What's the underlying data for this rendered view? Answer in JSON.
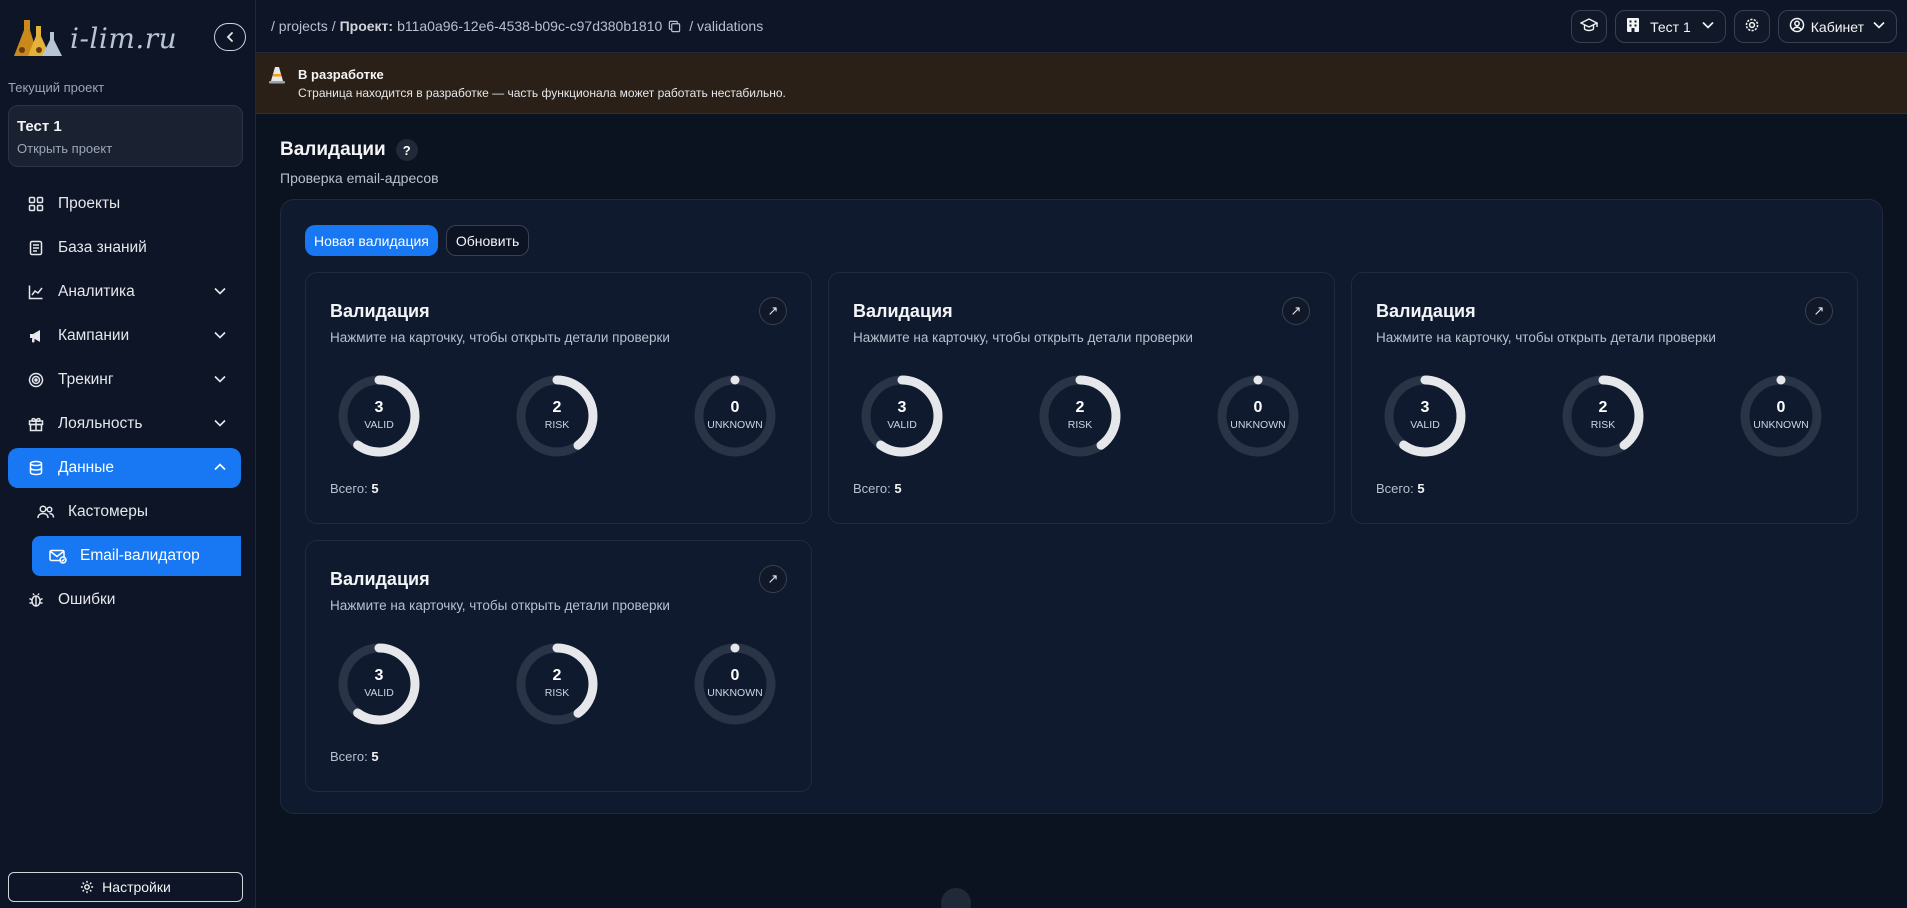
{
  "logo": {
    "text": "i-lim.ru"
  },
  "sidebar": {
    "current_project_label": "Текущий проект",
    "project": {
      "name": "Тест 1",
      "open_label": "Открыть проект"
    },
    "items": [
      {
        "label": "Проекты",
        "icon": "grid-icon"
      },
      {
        "label": "База знаний",
        "icon": "document-icon"
      },
      {
        "label": "Аналитика",
        "icon": "chart-icon",
        "expandable": true
      },
      {
        "label": "Кампании",
        "icon": "megaphone-icon",
        "expandable": true
      },
      {
        "label": "Трекинг",
        "icon": "target-icon",
        "expandable": true
      },
      {
        "label": "Лояльность",
        "icon": "gift-icon",
        "expandable": true
      },
      {
        "label": "Данные",
        "icon": "database-icon",
        "expandable": true,
        "active": true
      },
      {
        "label": "Ошибки",
        "icon": "bug-icon"
      }
    ],
    "sub_items": [
      {
        "label": "Кастомеры",
        "icon": "users-icon"
      },
      {
        "label": "Email-валидатор",
        "icon": "mail-check-icon",
        "active": true
      }
    ],
    "settings_label": "Настройки"
  },
  "topbar": {
    "crumb_projects": "/ projects /",
    "crumb_project_label": "Проект:",
    "crumb_project_id": "b11a0a96-12e6-4538-b09c-c97d380b1810",
    "crumb_current": "/ validations",
    "project_select": "Тест 1",
    "cabinet_label": "Кабинет"
  },
  "banner": {
    "title": "В разработке",
    "text": "Страница находится в разработке — часть функционала может работать нестабильно."
  },
  "page": {
    "title": "Валидации",
    "help": "?",
    "subtitle": "Проверка email-адресов",
    "new_button": "Новая валидация",
    "refresh_button": "Обновить"
  },
  "cards": [
    {
      "title": "Валидация",
      "subtitle": "Нажмите на карточку, чтобы открыть детали проверки",
      "open": "↗",
      "valid": "3",
      "valid_label": "VALID",
      "risk": "2",
      "risk_label": "RISK",
      "unknown": "0",
      "unknown_label": "UNKNOWN",
      "total_label": "Всего:",
      "total": "5"
    },
    {
      "title": "Валидация",
      "subtitle": "Нажмите на карточку, чтобы открыть детали проверки",
      "open": "↗",
      "valid": "3",
      "valid_label": "VALID",
      "risk": "2",
      "risk_label": "RISK",
      "unknown": "0",
      "unknown_label": "UNKNOWN",
      "total_label": "Всего:",
      "total": "5"
    },
    {
      "title": "Валидация",
      "subtitle": "Нажмите на карточку, чтобы открыть детали проверки",
      "open": "↗",
      "valid": "3",
      "valid_label": "VALID",
      "risk": "2",
      "risk_label": "RISK",
      "unknown": "0",
      "unknown_label": "UNKNOWN",
      "total_label": "Всего:",
      "total": "5"
    },
    {
      "title": "Валидация",
      "subtitle": "Нажмите на карточку, чтобы открыть детали проверки",
      "open": "↗",
      "valid": "3",
      "valid_label": "VALID",
      "risk": "2",
      "risk_label": "RISK",
      "unknown": "0",
      "unknown_label": "UNKNOWN",
      "total_label": "Всего:",
      "total": "5"
    }
  ],
  "colors": {
    "accent": "#1877f2",
    "ring_track": "#2a3447",
    "ring_fill": "#e5e7eb"
  }
}
